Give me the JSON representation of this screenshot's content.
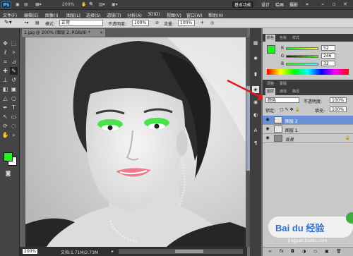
{
  "app": {
    "logo": "Ps",
    "zoom": "200%"
  },
  "workspaces": [
    "基本功能",
    "设计",
    "绘画",
    "摄影"
  ],
  "menu": [
    "文件(F)",
    "编辑(E)",
    "图像(I)",
    "图层(L)",
    "选择(S)",
    "滤镜(T)",
    "分析(A)",
    "3D(D)",
    "视图(V)",
    "窗口(W)",
    "帮助(H)"
  ],
  "options": {
    "mode_label": "模式:",
    "mode_value": "正常",
    "opacity_label": "不透明度:",
    "opacity_value": "100%",
    "flow_label": "流量:",
    "flow_value": "100%"
  },
  "document": {
    "tab_title": "1.jpg @ 200% (图层 2, RGB/8) *"
  },
  "status": {
    "zoom": "200%",
    "doc_info": "文档:1.71M/2.73M"
  },
  "color_panel": {
    "tabs": [
      "颜色",
      "色板",
      "样式"
    ],
    "r_label": "R",
    "g_label": "G",
    "b_label": "B",
    "r_value": "52",
    "g_value": "246",
    "b_value": "32",
    "fg_color": "#1ef41e"
  },
  "adjust_tabs": [
    "调整",
    "蒙版"
  ],
  "layers_panel": {
    "tabs": [
      "图层",
      "通道",
      "路径"
    ],
    "blend_mode": "颜色",
    "opacity_label": "不透明度:",
    "opacity_value": "100%",
    "lock_label": "锁定:",
    "fill_label": "填充:",
    "fill_value": "100%",
    "layers": [
      {
        "name": "图层 2",
        "selected": true
      },
      {
        "name": "图层 1",
        "selected": false
      },
      {
        "name": "背景",
        "selected": false
      }
    ]
  },
  "watermark": {
    "text": "Bai du 经验",
    "url": "jingyan.baidu.com"
  }
}
